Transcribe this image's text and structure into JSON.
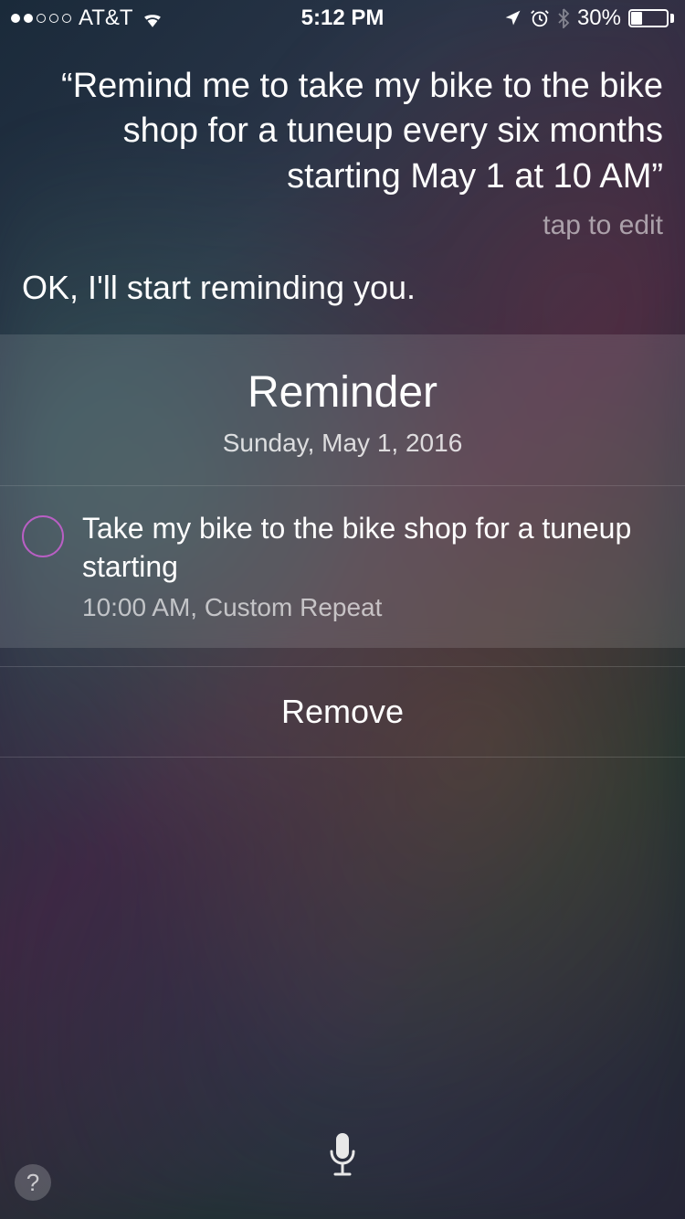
{
  "status_bar": {
    "carrier": "AT&T",
    "time": "5:12 PM",
    "battery_percent": "30%"
  },
  "siri": {
    "user_query": "“Remind me to take my bike to the bike shop for a tuneup every six months starting May 1 at 10 AM”",
    "tap_to_edit": "tap to edit",
    "response": "OK, I'll start reminding you."
  },
  "reminder_card": {
    "title": "Reminder",
    "date": "Sunday, May 1, 2016",
    "item": {
      "text": "Take my bike to the bike shop for a tuneup starting",
      "meta": "10:00 AM, Custom Repeat"
    },
    "remove_label": "Remove"
  },
  "help_label": "?"
}
